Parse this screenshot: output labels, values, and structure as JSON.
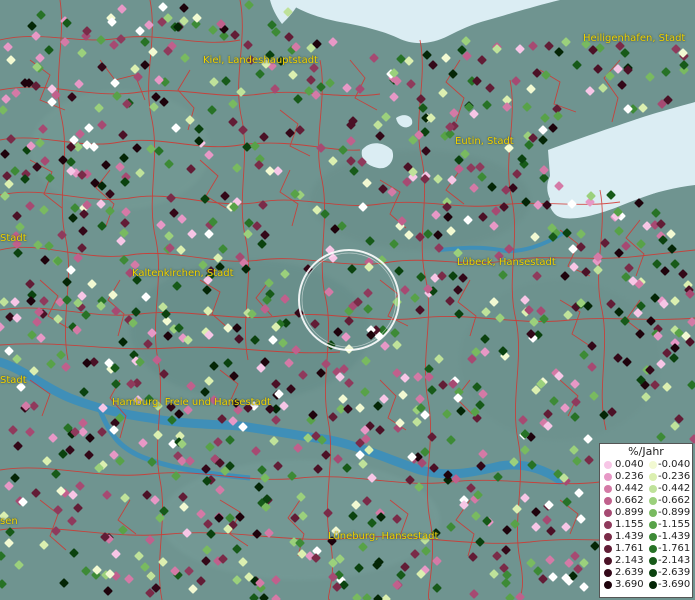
{
  "map": {
    "cities": [
      {
        "name": "Heiligenhafen, Stadt",
        "id": "heiligenhafen"
      },
      {
        "name": "Kiel, Landeshauptstadt",
        "id": "kiel"
      },
      {
        "name": "Eutin, Stadt",
        "id": "eutin"
      },
      {
        "name": "Stadt",
        "id": "stadt-west"
      },
      {
        "name": "Kaltenkirchen, Stadt",
        "id": "kaltenkirchen"
      },
      {
        "name": "Lübeck, Hansestadt",
        "id": "luebeck"
      },
      {
        "name": "Stadt",
        "id": "stadt-west-2"
      },
      {
        "name": "Hamburg, Freie und Hansestadt",
        "id": "hamburg"
      },
      {
        "name": "sen",
        "id": "sen"
      },
      {
        "name": "Lüneburg, Hansestadt",
        "id": "lueneburg"
      }
    ],
    "colors": {
      "land": "#6f9490",
      "sea": "#dbedf3",
      "river": "#3f8fb8",
      "border": "#d4342e",
      "city_label": "#f2d300",
      "focus_circle": "#ffffff"
    },
    "legend": {
      "title": "%/Jahr",
      "rows": [
        {
          "pos": "0.040",
          "pos_color": "#f7c6e6",
          "neg": "-0.040",
          "neg_color": "#f2f9d2"
        },
        {
          "pos": "0.236",
          "pos_color": "#e798c6",
          "neg": "-0.236",
          "neg_color": "#dbefb0"
        },
        {
          "pos": "0.442",
          "pos_color": "#d47aa6",
          "neg": "-0.442",
          "neg_color": "#bfe29a"
        },
        {
          "pos": "0.662",
          "pos_color": "#c0608c",
          "neg": "-0.662",
          "neg_color": "#9bd07c"
        },
        {
          "pos": "0.899",
          "pos_color": "#a64a72",
          "neg": "-0.899",
          "neg_color": "#79ba60"
        },
        {
          "pos": "1.155",
          "pos_color": "#8f3a5c",
          "neg": "-1.155",
          "neg_color": "#58a248"
        },
        {
          "pos": "1.439",
          "pos_color": "#7a2b48",
          "neg": "-1.439",
          "neg_color": "#3d8a36"
        },
        {
          "pos": "1.761",
          "pos_color": "#621d36",
          "neg": "-1.761",
          "neg_color": "#277226"
        },
        {
          "pos": "2.143",
          "pos_color": "#4b1126",
          "neg": "-2.143",
          "neg_color": "#175a19"
        },
        {
          "pos": "2.639",
          "pos_color": "#330818",
          "neg": "-2.639",
          "neg_color": "#0b420f"
        },
        {
          "pos": "3.690",
          "pos_color": "#1e030c",
          "neg": "-3.690",
          "neg_color": "#042606"
        }
      ]
    }
  }
}
